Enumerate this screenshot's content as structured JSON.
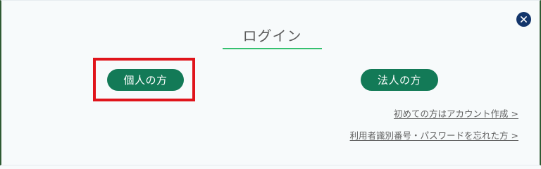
{
  "dialog": {
    "title": "ログイン",
    "close_icon": "close-icon"
  },
  "buttons": {
    "personal_label": "個人の方",
    "corporate_label": "法人の方"
  },
  "links": {
    "first_time": "初めての方はアカウント作成 >",
    "forgot": "利用者識別番号・パスワードを忘れた方 >"
  },
  "colors": {
    "button_bg": "#137a57",
    "accent_underline": "#35c06f",
    "highlight_border": "#e0141b",
    "close_bg": "#13356b"
  }
}
